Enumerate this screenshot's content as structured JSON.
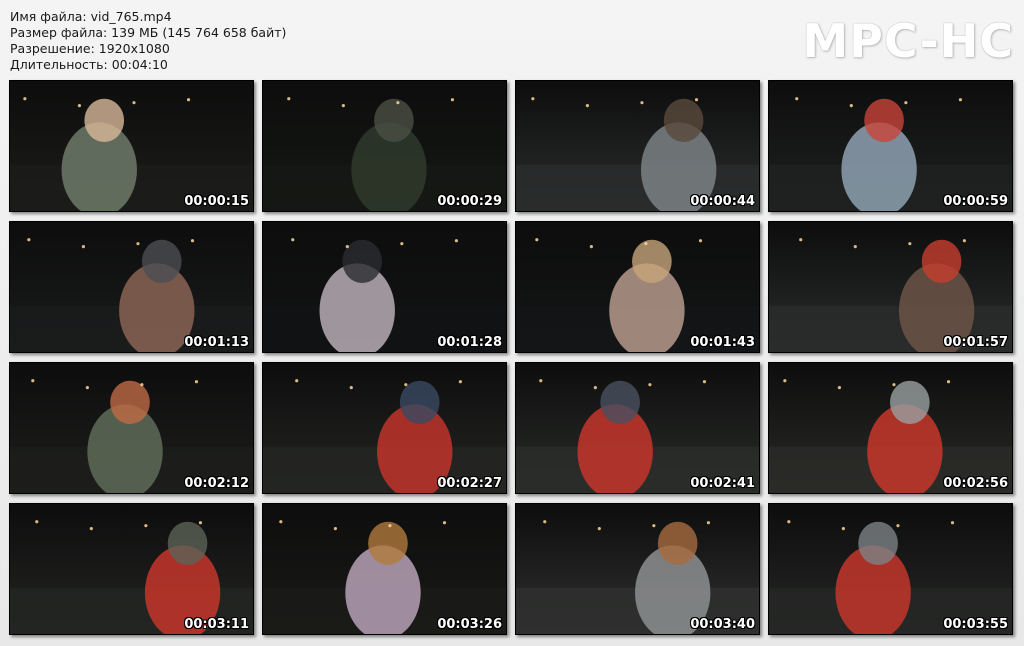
{
  "info": {
    "filename": "Имя файла: vid_765.mp4",
    "filesize": "Размер файла: 139 МБ (145 764 658 байт)",
    "resolution": "Разрешение: 1920x1080",
    "duration": "Длительность: 00:04:10"
  },
  "logo": "MPC-HC",
  "thumbnails": [
    {
      "time": "00:00:15",
      "bg": "#1c1c1a",
      "accent": "#6f7a6a",
      "detail": "#d8b89a"
    },
    {
      "time": "00:00:29",
      "bg": "#151814",
      "accent": "#2f3a2c",
      "detail": "#4a4f44"
    },
    {
      "time": "00:00:44",
      "bg": "#2b2d2d",
      "accent": "#7b8185",
      "detail": "#5a4a3c"
    },
    {
      "time": "00:00:59",
      "bg": "#1f2220",
      "accent": "#8ea1b1",
      "detail": "#c9433a"
    },
    {
      "time": "00:01:13",
      "bg": "#1a1b1c",
      "accent": "#8a6453",
      "detail": "#4b4d52"
    },
    {
      "time": "00:01:28",
      "bg": "#121314",
      "accent": "#b9aeb6",
      "detail": "#2b2c30"
    },
    {
      "time": "00:01:43",
      "bg": "#141516",
      "accent": "#b79a8c",
      "detail": "#c6a57a"
    },
    {
      "time": "00:01:57",
      "bg": "#2a2c2c",
      "accent": "#6c5347",
      "detail": "#c73d2e"
    },
    {
      "time": "00:02:12",
      "bg": "#1d1e1c",
      "accent": "#5f6b58",
      "detail": "#bf6a45"
    },
    {
      "time": "00:02:27",
      "bg": "#242623",
      "accent": "#c0342a",
      "detail": "#3a4a63"
    },
    {
      "time": "00:02:41",
      "bg": "#2a2d2a",
      "accent": "#c5362b",
      "detail": "#4a5060"
    },
    {
      "time": "00:02:56",
      "bg": "#2a2b28",
      "accent": "#c7372c",
      "detail": "#9aa0a0"
    },
    {
      "time": "00:03:11",
      "bg": "#232522",
      "accent": "#c6362b",
      "detail": "#5d6356"
    },
    {
      "time": "00:03:26",
      "bg": "#1a1a18",
      "accent": "#b7a2b7",
      "detail": "#b07a3c"
    },
    {
      "time": "00:03:40",
      "bg": "#2e302e",
      "accent": "#8d8f90",
      "detail": "#a86a3f"
    },
    {
      "time": "00:03:55",
      "bg": "#252725",
      "accent": "#c3362c",
      "detail": "#7d8286"
    }
  ]
}
